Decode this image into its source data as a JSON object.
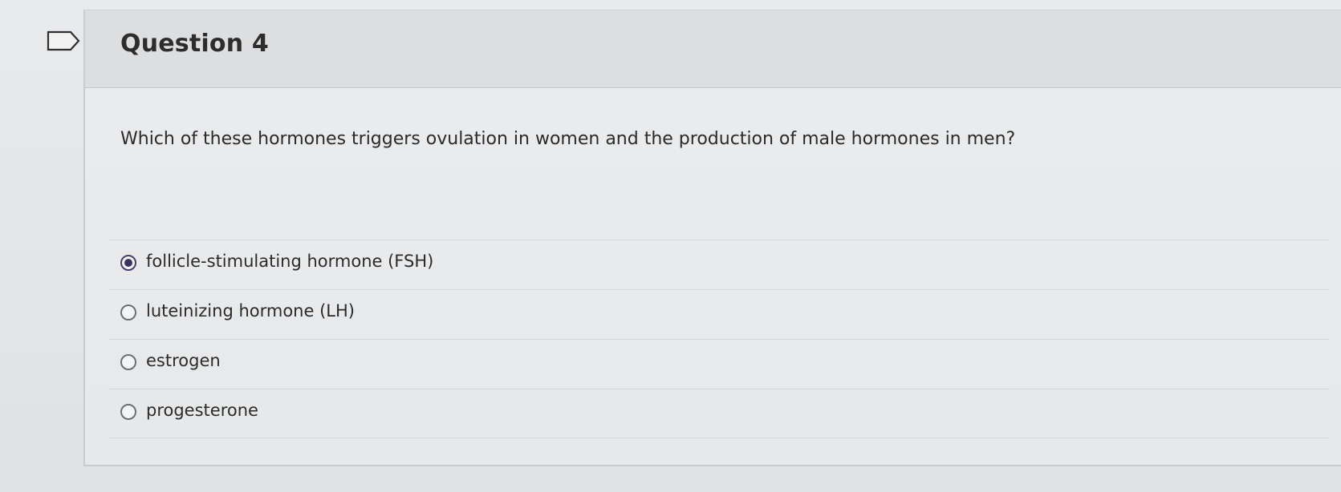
{
  "question": {
    "title": "Question 4",
    "text": "Which of these hormones triggers ovulation in women and the production of male hormones in men?",
    "flag_icon": "flag-icon",
    "answers": [
      {
        "label": "follicle-stimulating hormone (FSH)",
        "selected": true
      },
      {
        "label": "luteinizing hormone (LH)",
        "selected": false
      },
      {
        "label": "estrogen",
        "selected": false
      },
      {
        "label": "progesterone",
        "selected": false
      }
    ]
  },
  "colors": {
    "selected_radio": "#3d325e",
    "header_background": "#dcdedf"
  }
}
